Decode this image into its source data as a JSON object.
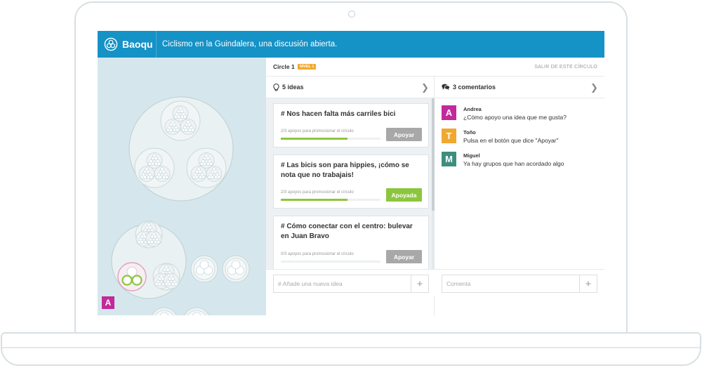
{
  "app": {
    "brand": "Baoqu",
    "title": "Ciclismo en la Guindalera, una discusión abierta.",
    "accent_color": "#1592c6"
  },
  "circle": {
    "name": "Circle 1",
    "level_badge": "NIVEL 1",
    "exit_label": "SALIR DE ESTE CÍRCULO"
  },
  "user_avatar": {
    "letter": "A",
    "color": "#c2299a"
  },
  "ideas": {
    "header": "5 ideas",
    "items": [
      {
        "title": "# Nos hacen falta más carriles bici",
        "meta": "2/3 apoyos para promocionar el círculo",
        "progress": 0.67,
        "button": "Apoyar",
        "button_color": "#a8a8a8"
      },
      {
        "title": "# Las bicis son para hippies, ¡cómo se nota que no trabajais!",
        "meta": "2/3 apoyos para promocionar el círculo",
        "progress": 0.67,
        "button": "Apoyada",
        "button_color": "#8cc63e"
      },
      {
        "title": "# Cómo conectar con el centro: bulevar en Juan Bravo",
        "meta": "0/3 apoyos para promocionar el círculo",
        "progress": 0,
        "button": "Apoyar",
        "button_color": "#a8a8a8"
      }
    ],
    "input_placeholder": "# Añade una nueva idea",
    "add_symbol": "+"
  },
  "comments": {
    "header": "3 comentarios",
    "items": [
      {
        "letter": "A",
        "name": "Andrea",
        "text": "¿Cómo apoyo una idea que me gusta?",
        "color": "#c2299a"
      },
      {
        "letter": "T",
        "name": "Toño",
        "text": "Pulsa en el botón que dice \"Apoyar\"",
        "color": "#f0a830"
      },
      {
        "letter": "M",
        "name": "Miguel",
        "text": "Ya hay grupos que han acordado algo",
        "color": "#3e8e80"
      }
    ],
    "input_placeholder": "Comenta",
    "add_symbol": "+"
  },
  "icons": {
    "brand": "baoqu-logo-icon",
    "ideas": "lightbulb-icon",
    "comments": "speech-bubbles-icon",
    "chevron": "chevron-right-icon"
  }
}
